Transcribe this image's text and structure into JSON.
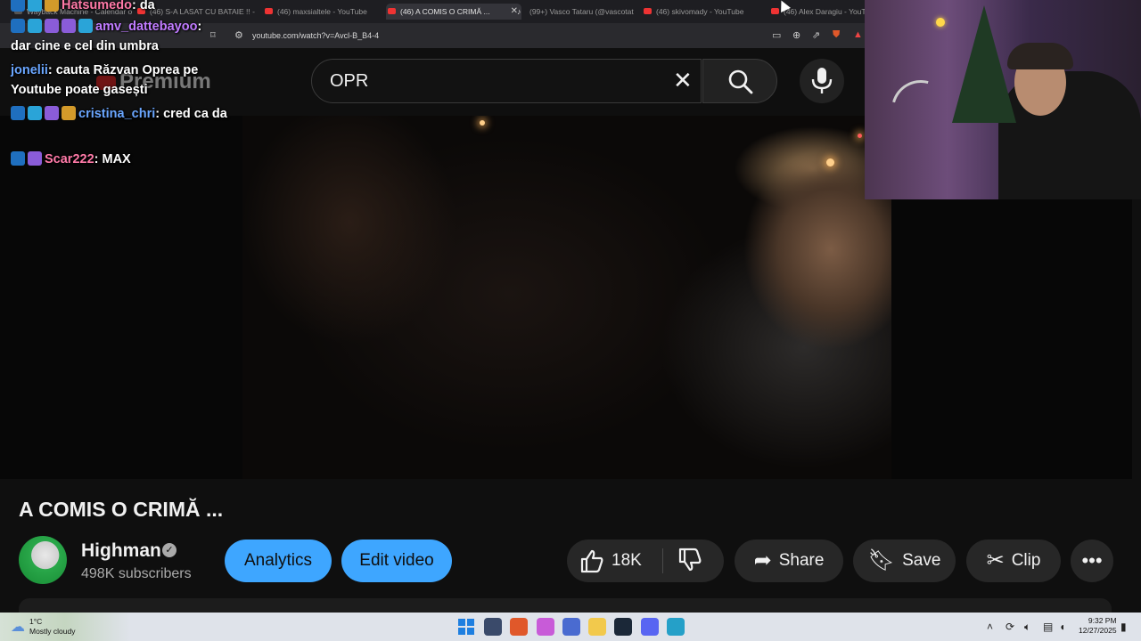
{
  "browser": {
    "tabs": [
      {
        "label": "Wayback Machine - Calendar o",
        "icon": "wayback-icon"
      },
      {
        "label": "(46) S-A LASAT CU BATAIE !! -",
        "icon": "youtube-icon"
      },
      {
        "label": "(46) maxsialtele - YouTube",
        "icon": "youtube-icon"
      },
      {
        "label": "(46) A COMIS O CRIMĂ ...",
        "icon": "youtube-icon"
      },
      {
        "label": "(99+) Vasco Tataru (@vascotat",
        "icon": "tiktok-icon"
      },
      {
        "label": "(46) skivomady - YouTube",
        "icon": "youtube-icon"
      },
      {
        "label": "(46) Alex Daragiu - YouTu",
        "icon": "youtube-icon"
      }
    ],
    "url": "youtube.com/watch?v=Avcl-B_B4-4"
  },
  "chat": [
    {
      "user": "Hatsumedo",
      "text": "da",
      "color": "pink"
    },
    {
      "user": "amv_dattebayoo",
      "text": "dar cine e cel din umbra",
      "color": "purple"
    },
    {
      "user": "jonelii",
      "text": "cauta Răzvan Oprea pe Youtube poate gasești",
      "color": "blue"
    },
    {
      "user": "cristina_chri",
      "text": "cred ca da",
      "color": "blue"
    },
    {
      "user": "Scar222",
      "text": "MAX",
      "color": "pink"
    }
  ],
  "youtube": {
    "logo_text": "Premium",
    "search": {
      "value": "OPR",
      "clear_icon": "close-icon",
      "search_icon": "search-icon",
      "mic_icon": "mic-icon"
    },
    "video": {
      "title": "A COMIS O CRIMĂ ...",
      "channel": "Highman",
      "verified_icon": "check-icon",
      "subscribers": "498K subscribers",
      "buttons": {
        "analytics": "Analytics",
        "edit": "Edit video",
        "likes": "18K",
        "share": "Share",
        "save": "Save",
        "clip": "Clip"
      }
    }
  },
  "taskbar": {
    "weather_temp": "1°C",
    "weather_cond": "Mostly cloudy",
    "time": "9:32 PM",
    "date": "12/27/2025"
  }
}
